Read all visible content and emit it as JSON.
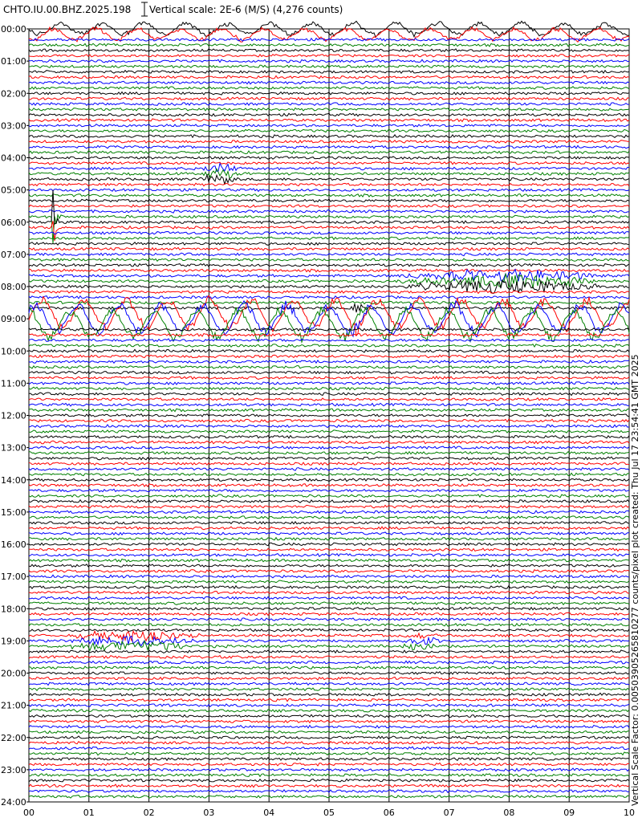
{
  "header": {
    "station": "CHTO.IU.00.BHZ.2025.198",
    "scale_label": "Vertical scale: 2E-6 (M/S) (4,276 counts)"
  },
  "side_note": "Vertical Scale Factor: 0.00503905265810277 counts/pixel plot created: Thu Jul 17 23:54:41 GMT 2025",
  "chart_data": {
    "type": "line",
    "title": "CHTO.IU.00.BHZ.2025.198",
    "hour_labels": [
      "00:00",
      "01:00",
      "02:00",
      "03:00",
      "04:00",
      "05:00",
      "06:00",
      "07:00",
      "08:00",
      "09:00",
      "10:00",
      "11:00",
      "12:00",
      "13:00",
      "14:00",
      "15:00",
      "16:00",
      "17:00",
      "18:00",
      "19:00",
      "20:00",
      "21:00",
      "22:00",
      "23:00",
      "24:00"
    ],
    "minute_labels": [
      "00",
      "01",
      "02",
      "03",
      "04",
      "05",
      "06",
      "07",
      "08",
      "09",
      "10"
    ],
    "x_range_minutes": [
      0,
      10
    ],
    "y_range_hours": [
      0,
      24
    ],
    "traces_per_hour": 6,
    "trace_count": 144,
    "trace_colors": [
      "#000000",
      "#ff0000",
      "#0000ff",
      "#008000"
    ],
    "grid": true,
    "events": [
      {
        "hour": 0.0,
        "start_min": 0.0,
        "end_min": 10.0,
        "amplitude": 9,
        "kind": "microseism"
      },
      {
        "hour": 4.5,
        "start_min": 2.8,
        "end_min": 3.6,
        "amplitude": 6,
        "kind": "local"
      },
      {
        "hour": 6.0,
        "start_min": 0.4,
        "end_min": 0.6,
        "amplitude": 60,
        "kind": "spike"
      },
      {
        "hour": 7.5,
        "start_min": 0.5,
        "end_min": 0.6,
        "amplitude": 18,
        "kind": "spike"
      },
      {
        "hour": 7.83,
        "start_min": 6.0,
        "end_min": 9.8,
        "amplitude": 8,
        "kind": "teleseism"
      },
      {
        "hour": 8.83,
        "start_min": 5.3,
        "end_min": 5.7,
        "amplitude": 7,
        "kind": "local"
      },
      {
        "hour": 9.0,
        "start_min": 0.0,
        "end_min": 10.0,
        "amplitude": 22,
        "kind": "surface-waves"
      },
      {
        "hour": 19.0,
        "start_min": 0.4,
        "end_min": 3.0,
        "amplitude": 6,
        "kind": "regional"
      },
      {
        "hour": 19.0,
        "start_min": 6.2,
        "end_min": 6.9,
        "amplitude": 5,
        "kind": "local"
      }
    ]
  }
}
